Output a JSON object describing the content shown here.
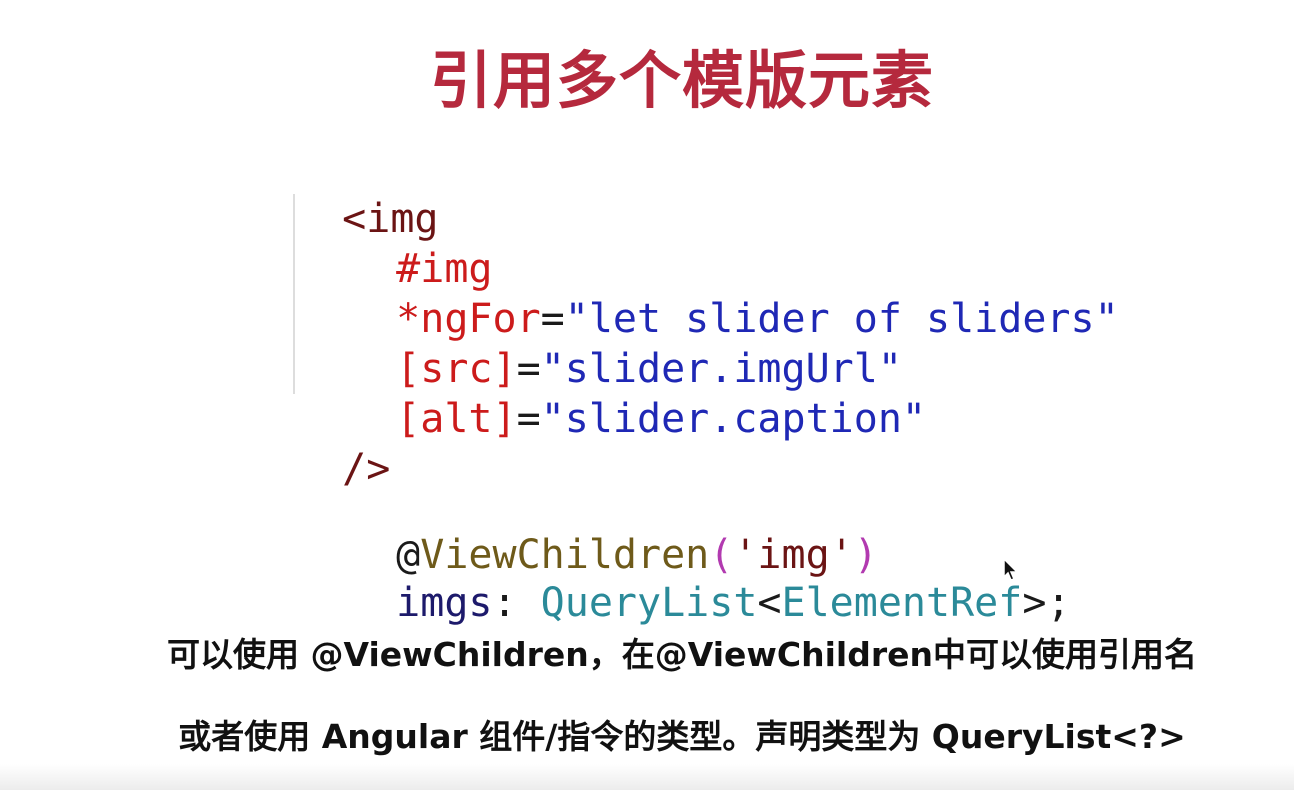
{
  "title": "引用多个模版元素",
  "code": {
    "line1": {
      "open": "<img"
    },
    "line2": {
      "ref": "#img"
    },
    "line3": {
      "attr": "*ngFor",
      "eq": "=",
      "value": "\"let slider of sliders\""
    },
    "line4": {
      "attr": "[src]",
      "eq": "=",
      "value": "\"slider.imgUrl\""
    },
    "line5": {
      "attr": "[alt]",
      "eq": "=",
      "value": "\"slider.caption\""
    },
    "line6": {
      "close": "/>"
    },
    "line7": {
      "at": "@",
      "decorator": "ViewChildren",
      "paren_open": "(",
      "arg": "'img'",
      "paren_close": ")"
    },
    "line8": {
      "name": "imgs",
      "colon": ": ",
      "type": "QueryList",
      "lt": "<",
      "generic": "ElementRef",
      "gt": ">",
      "semi": ";"
    }
  },
  "captions": {
    "line1": "可以使用 @ViewChildren，在@ViewChildren中可以使用引用名",
    "line2": "或者使用 Angular 组件/指令的类型。声明类型为 QueryList<?>"
  },
  "colors": {
    "title": "#b5293d",
    "tag": "#6b1414",
    "attr": "#cc1b1b",
    "string": "#1f28b5",
    "punct": "#1a1a1a",
    "decorator": "#6e5a1a",
    "paren": "#b23ab0",
    "arg": "#6b1414",
    "identifier": "#1d1a6b",
    "type": "#2b8a99"
  },
  "icons": {
    "cursor": "mouse-pointer-icon"
  }
}
